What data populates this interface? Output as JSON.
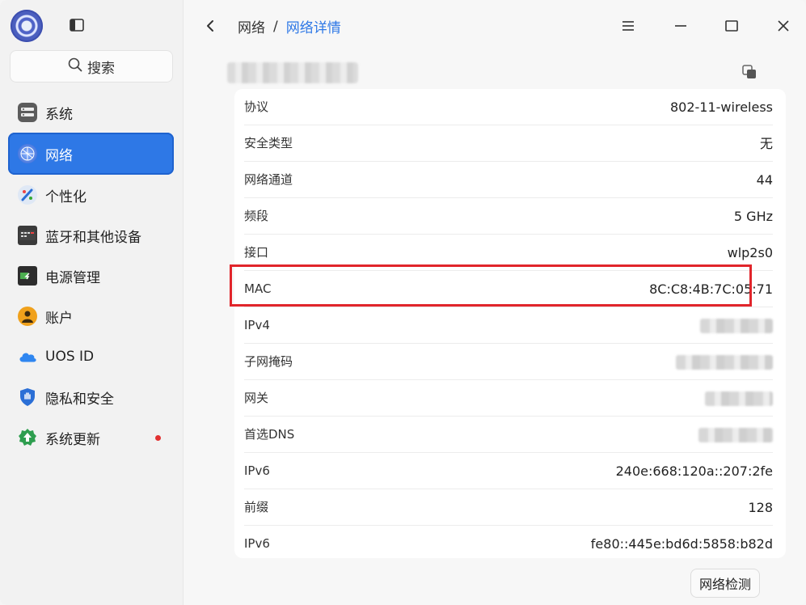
{
  "sidebar": {
    "search_label": "搜索",
    "items": [
      {
        "label": "系统",
        "icon": "system-icon"
      },
      {
        "label": "网络",
        "icon": "network-icon",
        "active": true
      },
      {
        "label": "个性化",
        "icon": "personalization-icon"
      },
      {
        "label": "蓝牙和其他设备",
        "icon": "bluetooth-devices-icon"
      },
      {
        "label": "电源管理",
        "icon": "power-icon"
      },
      {
        "label": "账户",
        "icon": "account-icon"
      },
      {
        "label": "UOS ID",
        "icon": "cloud-icon"
      },
      {
        "label": "隐私和安全",
        "icon": "privacy-shield-icon"
      },
      {
        "label": "系统更新",
        "icon": "update-icon",
        "badge": "red-dot"
      }
    ]
  },
  "breadcrumb": {
    "parent": "网络",
    "separator": "/",
    "current": "网络详情"
  },
  "details": [
    {
      "key": "协议",
      "value": "802-11-wireless"
    },
    {
      "key": "安全类型",
      "value": "无"
    },
    {
      "key": "网络通道",
      "value": "44"
    },
    {
      "key": "频段",
      "value": "5 GHz"
    },
    {
      "key": "接口",
      "value": "wlp2s0"
    },
    {
      "key": "MAC",
      "value": "8C:C8:4B:7C:05:71"
    },
    {
      "key": "IPv4",
      "value": ""
    },
    {
      "key": "子网掩码",
      "value": ""
    },
    {
      "key": "网关",
      "value": ""
    },
    {
      "key": "首选DNS",
      "value": ""
    },
    {
      "key": "IPv6",
      "value": "240e:668:120a::207:2fe"
    },
    {
      "key": "前缀",
      "value": "128"
    },
    {
      "key": "IPv6",
      "value": "fe80::445e:bd6d:5858:b82d"
    }
  ],
  "actions": {
    "network_check_label": "网络检测"
  },
  "colors": {
    "accent": "#2e78e6",
    "highlight": "#e1252b",
    "badge": "#e23131"
  }
}
